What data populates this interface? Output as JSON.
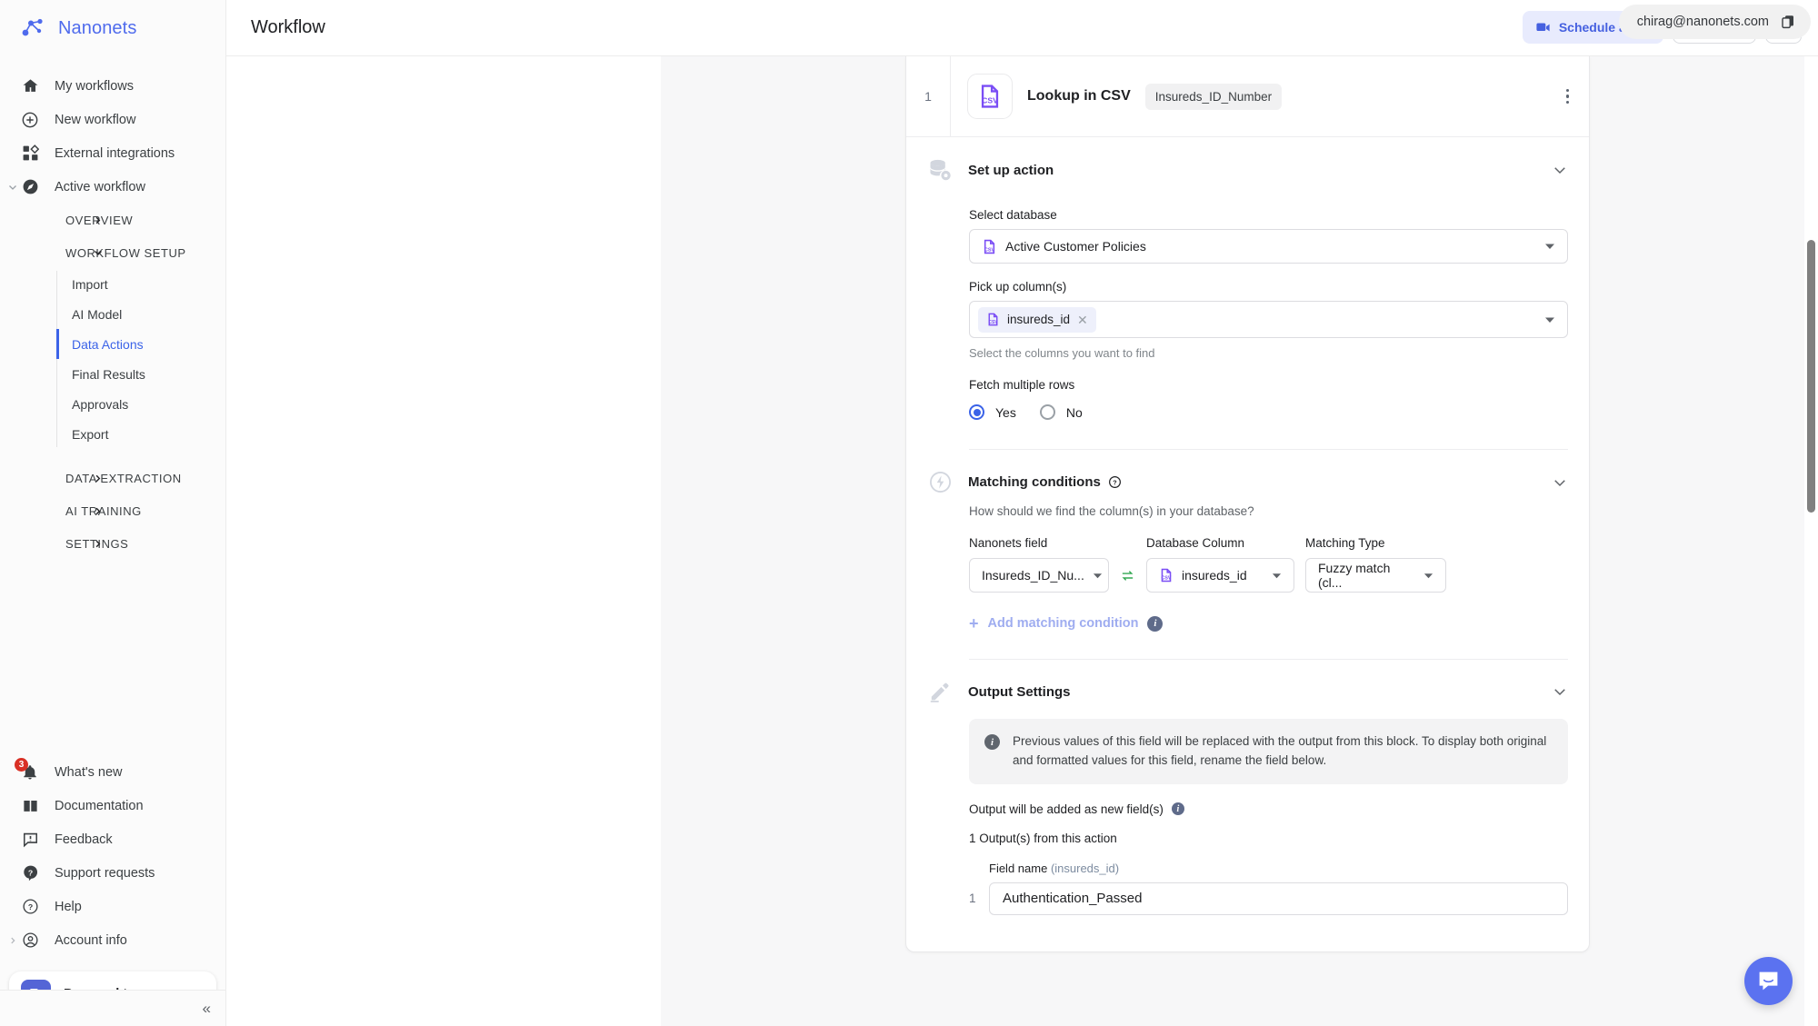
{
  "brand": {
    "name": "Nanonets",
    "logo_icon": "nanonets-logo-icon"
  },
  "sidebar": {
    "primary": [
      {
        "label": "My workflows",
        "icon": "home-icon"
      },
      {
        "label": "New workflow",
        "icon": "plus-circle-icon"
      },
      {
        "label": "External integrations",
        "icon": "grid-apps-icon"
      },
      {
        "label": "Active workflow",
        "icon": "compass-icon",
        "expanded": true
      }
    ],
    "groups": [
      {
        "label": "OVERVIEW",
        "expanded": false
      },
      {
        "label": "WORKFLOW SETUP",
        "expanded": true,
        "items": [
          {
            "label": "Import",
            "active": false
          },
          {
            "label": "AI Model",
            "active": false
          },
          {
            "label": "Data Actions",
            "active": true
          },
          {
            "label": "Final Results",
            "active": false
          },
          {
            "label": "Approvals",
            "active": false
          },
          {
            "label": "Export",
            "active": false
          }
        ]
      },
      {
        "label": "DATA EXTRACTION",
        "expanded": false
      },
      {
        "label": "AI TRAINING",
        "expanded": false
      },
      {
        "label": "SETTINGS",
        "expanded": false
      }
    ],
    "bottom": [
      {
        "label": "What's new",
        "icon": "bell-icon",
        "badge": "3"
      },
      {
        "label": "Documentation",
        "icon": "book-icon"
      },
      {
        "label": "Feedback",
        "icon": "feedback-chat-icon"
      },
      {
        "label": "Support requests",
        "icon": "question-filled-icon"
      },
      {
        "label": "Help",
        "icon": "help-circle-icon"
      },
      {
        "label": "Account info",
        "icon": "account-circle-icon"
      }
    ],
    "team": {
      "label": "Personal team",
      "icon": "building-icon",
      "chevron": "chevron-up-icon"
    },
    "collapse_label": "«"
  },
  "header": {
    "title": "Workflow",
    "schedule_button": "Schedule a call",
    "email_tooltip": "chirag@nanonets.com",
    "copy_icon": "copy-icon"
  },
  "card": {
    "step_number": "1",
    "title": "Lookup in CSV",
    "chip": "Insureds_ID_Number",
    "file_icon": "csv-file-icon",
    "menu_icon": "kebab-menu-icon"
  },
  "setup": {
    "section_title": "Set up action",
    "section_icon": "database-settings-icon",
    "database_label": "Select database",
    "database_value": "Active Customer Policies",
    "columns_label": "Pick up column(s)",
    "column_tag": "insureds_id",
    "columns_helper": "Select the columns you want to find",
    "fetch_label": "Fetch multiple rows",
    "fetch_yes": "Yes",
    "fetch_no": "No",
    "fetch_selected": "Yes"
  },
  "matching": {
    "section_title": "Matching conditions",
    "section_icon": "lightning-circle-icon",
    "help_icon": "help-circle-icon",
    "subtitle": "How should we find the column(s) in your database?",
    "col_nanonets": "Nanonets field",
    "col_database": "Database Column",
    "col_type": "Matching Type",
    "row": {
      "nanonets_field": "Insureds_ID_Nu...",
      "database_column": "insureds_id",
      "matching_type": "Fuzzy match (cl..."
    },
    "add_condition": "Add matching condition",
    "swap_icon": "swap-horizontal-icon"
  },
  "output": {
    "section_title": "Output Settings",
    "section_icon": "pencil-icon",
    "notice": "Previous values of this field will be replaced with the output from this block. To display both original and formatted values for this field, rename the field below.",
    "new_fields_label": "Output will be added as new field(s)",
    "count_label": "1 Output(s) from this action",
    "field_name_label": "Field name",
    "field_name_source": "(insureds_id)",
    "rows": [
      {
        "index": "1",
        "value": "Authentication_Passed"
      }
    ]
  },
  "chat": {
    "icon": "intercom-chat-icon"
  },
  "colors": {
    "accent_blue": "#3b63e8",
    "brand_blue": "#4f6bed",
    "csv_purple": "#7a4df5",
    "badge_red": "#d93025",
    "green_swap": "#34a853"
  }
}
